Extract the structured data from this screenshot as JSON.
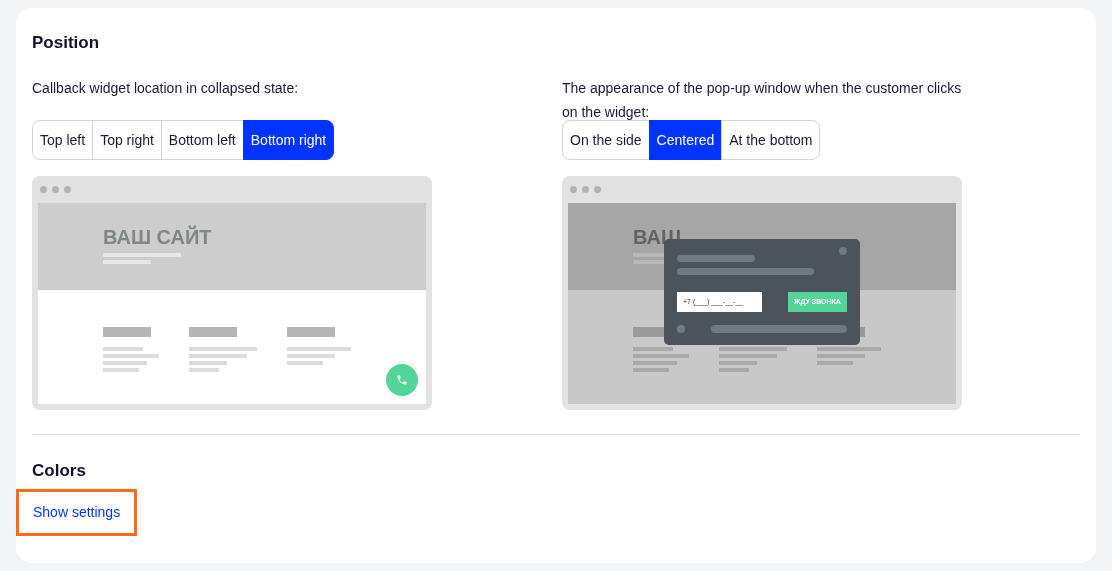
{
  "position": {
    "title": "Position",
    "location": {
      "label": "Callback widget location in collapsed state:",
      "options": [
        {
          "label": "Top left",
          "selected": false
        },
        {
          "label": "Top right",
          "selected": false
        },
        {
          "label": "Bottom left",
          "selected": false
        },
        {
          "label": "Bottom right",
          "selected": true
        }
      ],
      "preview": {
        "site_title": "ВАШ САЙТ"
      }
    },
    "popup": {
      "label": "The appearance of the pop-up window when the customer clicks on the widget:",
      "options": [
        {
          "label": "On the side",
          "selected": false
        },
        {
          "label": "Centered",
          "selected": true
        },
        {
          "label": "At the bottom",
          "selected": false
        }
      ],
      "preview": {
        "site_title": "ВАШ",
        "phone_placeholder": "+7 (___) ___-__-__",
        "submit": "ЖДУ ЗВОНКА"
      }
    }
  },
  "colors": {
    "title": "Colors",
    "link": {
      "label": "Show settings",
      "focused": true
    }
  }
}
